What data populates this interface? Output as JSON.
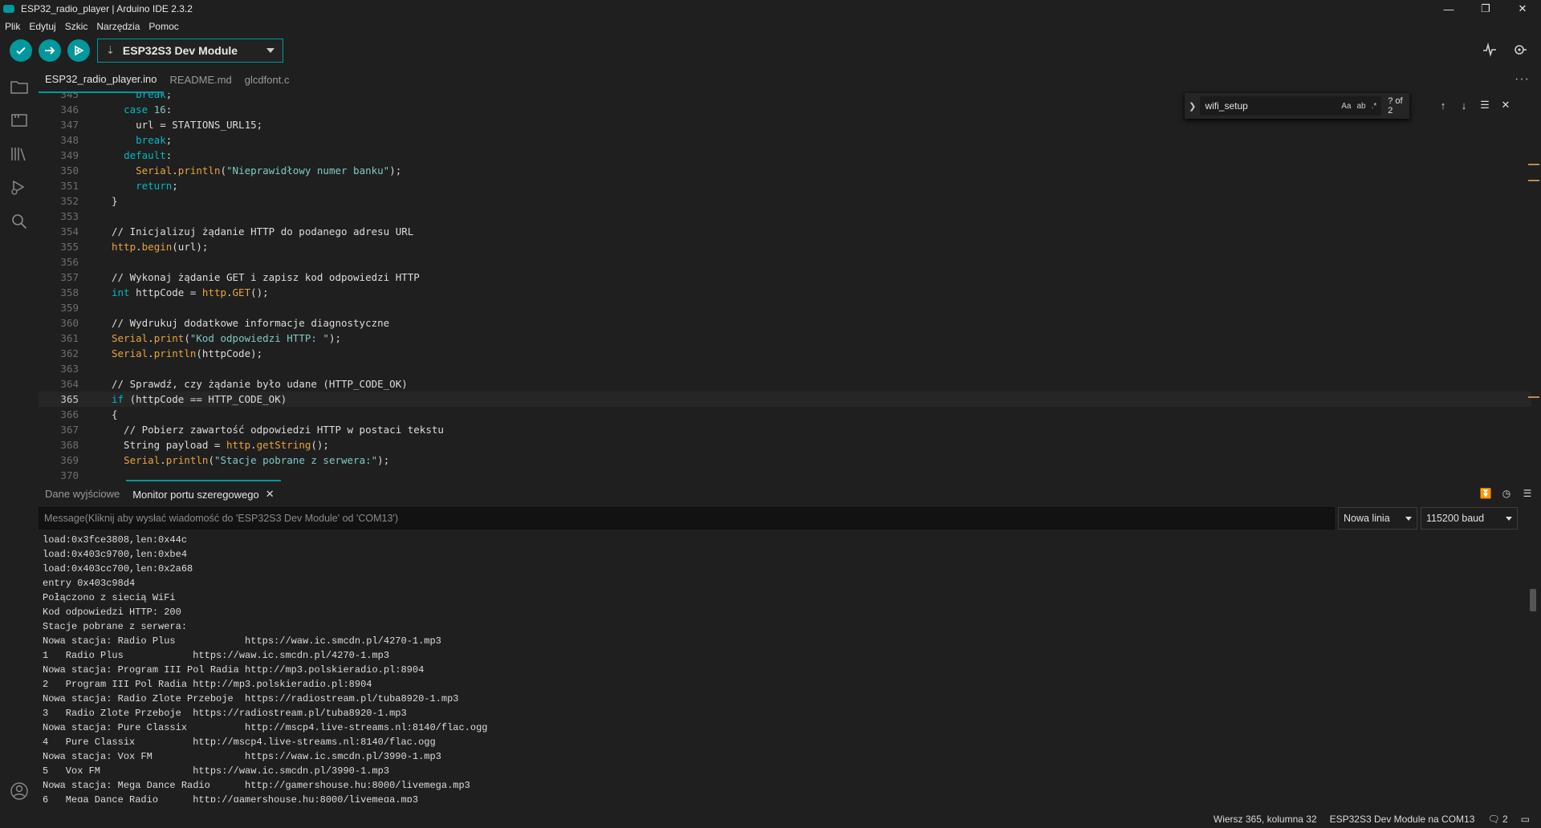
{
  "window": {
    "title": "ESP32_radio_player | Arduino IDE 2.3.2"
  },
  "menu": [
    "Plik",
    "Edytuj",
    "Szkic",
    "Narzędzia",
    "Pomoc"
  ],
  "toolbar": {
    "board": "ESP32S3 Dev Module"
  },
  "tabs": [
    "ESP32_radio_player.ino",
    "README.md",
    "glcdfont.c"
  ],
  "find": {
    "query": "wifi_setup",
    "count": "? of 2",
    "opt_case": "Aa",
    "opt_word": "ab",
    "opt_regex": ".*"
  },
  "code": [
    {
      "n": "345",
      "t": "    break;"
    },
    {
      "n": "346",
      "t": "  case 16:"
    },
    {
      "n": "347",
      "t": "    url = STATIONS_URL15;"
    },
    {
      "n": "348",
      "t": "    break;"
    },
    {
      "n": "349",
      "t": "  default:"
    },
    {
      "n": "350",
      "t": "    Serial.println(\"Nieprawidłowy numer banku\");"
    },
    {
      "n": "351",
      "t": "    return;"
    },
    {
      "n": "352",
      "t": "}"
    },
    {
      "n": "353",
      "t": ""
    },
    {
      "n": "354",
      "t": "// Inicjalizuj żądanie HTTP do podanego adresu URL"
    },
    {
      "n": "355",
      "t": "http.begin(url);"
    },
    {
      "n": "356",
      "t": ""
    },
    {
      "n": "357",
      "t": "// Wykonaj żądanie GET i zapisz kod odpowiedzi HTTP"
    },
    {
      "n": "358",
      "t": "int httpCode = http.GET();"
    },
    {
      "n": "359",
      "t": ""
    },
    {
      "n": "360",
      "t": "// Wydrukuj dodatkowe informacje diagnostyczne"
    },
    {
      "n": "361",
      "t": "Serial.print(\"Kod odpowiedzi HTTP: \");"
    },
    {
      "n": "362",
      "t": "Serial.println(httpCode);"
    },
    {
      "n": "363",
      "t": ""
    },
    {
      "n": "364",
      "t": "// Sprawdź, czy żądanie było udane (HTTP_CODE_OK)"
    },
    {
      "n": "365",
      "t": "if (httpCode == HTTP_CODE_OK)"
    },
    {
      "n": "366",
      "t": "{"
    },
    {
      "n": "367",
      "t": "  // Pobierz zawartość odpowiedzi HTTP w postaci tekstu"
    },
    {
      "n": "368",
      "t": "  String payload = http.getString();"
    },
    {
      "n": "369",
      "t": "  Serial.println(\"Stacje pobrane z serwera:\");"
    },
    {
      "n": "370",
      "t": ""
    }
  ],
  "panel": {
    "tab_output": "Dane wyjściowe",
    "tab_serial": "Monitor portu szeregowego",
    "message_placeholder": "Message(Kliknij aby wysłać wiadomość do 'ESP32S3 Dev Module' od 'COM13')",
    "line_ending": "Nowa linia",
    "baud": "115200 baud"
  },
  "serial_lines": [
    "load:0x3fce3808,len:0x44c",
    "load:0x403c9700,len:0xbe4",
    "load:0x403cc700,len:0x2a68",
    "entry 0x403c98d4",
    "Połączono z siecią WiFi",
    "Kod odpowiedzi HTTP: 200",
    "Stacje pobrane z serwera:",
    "Nowa stacja: Radio Plus            https://waw.ic.smcdn.pl/4270-1.mp3",
    "1   Radio Plus            https://waw.ic.smcdn.pl/4270-1.mp3",
    "Nowa stacja: Program III Pol Radia http://mp3.polskieradio.pl:8904",
    "2   Program III Pol Radia http://mp3.polskieradio.pl:8904",
    "Nowa stacja: Radio Zlote Przeboje  https://radiostream.pl/tuba8920-1.mp3",
    "3   Radio Zlote Przeboje  https://radiostream.pl/tuba8920-1.mp3",
    "Nowa stacja: Pure Classix          http://mscp4.live-streams.nl:8140/flac.ogg",
    "4   Pure Classix          http://mscp4.live-streams.nl:8140/flac.ogg",
    "Nowa stacja: Vox FM                https://waw.ic.smcdn.pl/3990-1.mp3",
    "5   Vox FM                https://waw.ic.smcdn.pl/3990-1.mp3",
    "Nowa stacja: Mega Dance Radio      http://gamershouse.hu:8000/livemega.mp3",
    "6   Mega Dance Radio      http://gamershouse.hu:8000/livemega.mp3"
  ],
  "status": {
    "cursor": "Wiersz 365, kolumna 32",
    "board_port": "ESP32S3 Dev Module na COM13",
    "notifications": "2"
  },
  "colors": {
    "accent": "#00979d",
    "background": "#1f1f1f"
  }
}
